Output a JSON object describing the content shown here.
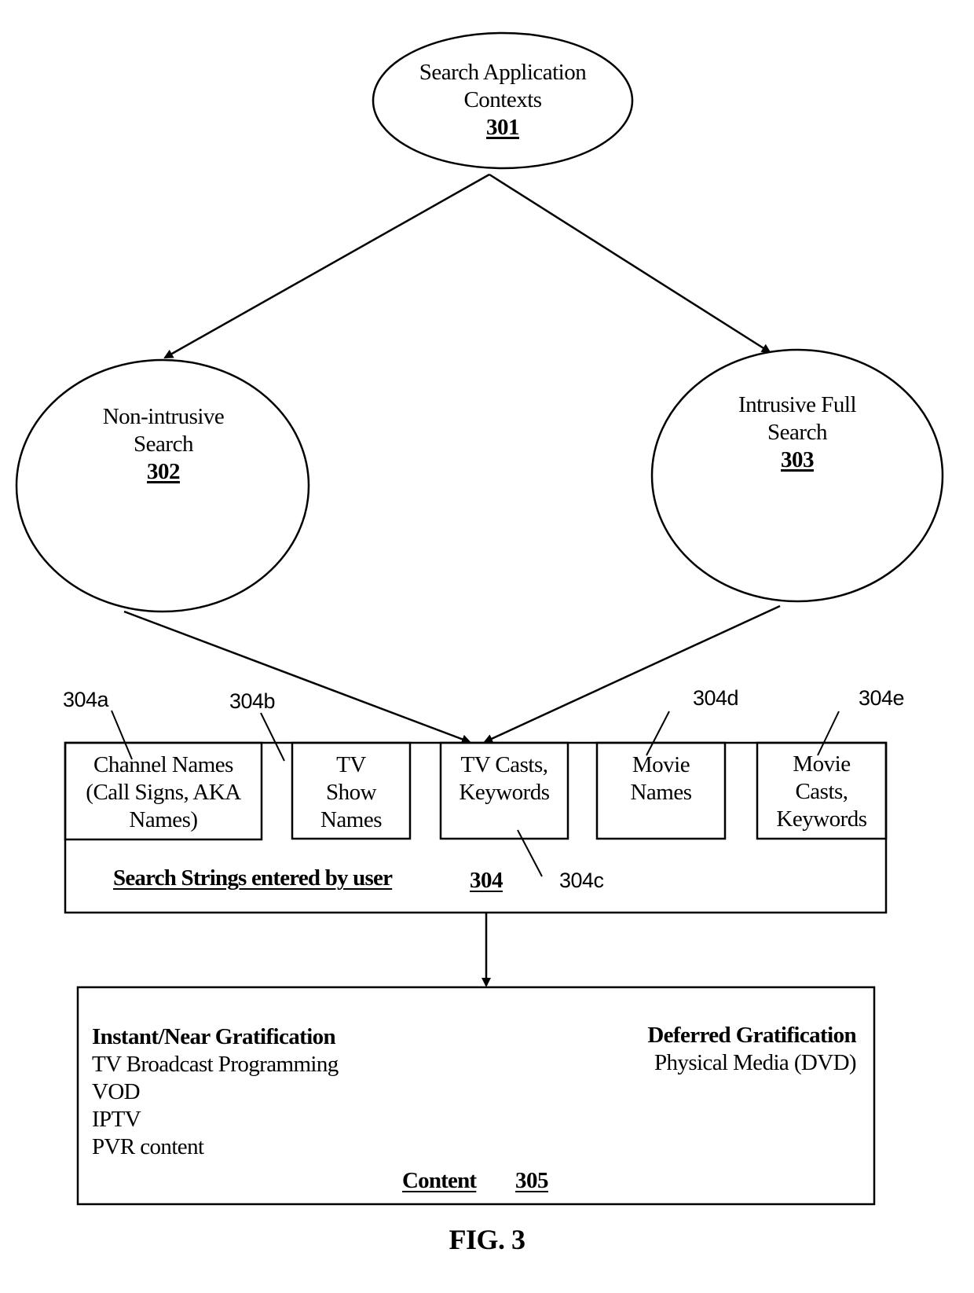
{
  "figure_label": "FIG. 3",
  "nodes": {
    "n301": {
      "lines": [
        "Search Application",
        "Contexts"
      ],
      "ref": "301"
    },
    "n302": {
      "lines": [
        "Non-intrusive",
        "Search"
      ],
      "ref": "302"
    },
    "n303": {
      "lines": [
        "Intrusive Full",
        "Search"
      ],
      "ref": "303"
    }
  },
  "search_strings": {
    "title": "Search Strings entered by user",
    "ref": "304",
    "boxes": [
      {
        "ref": "304a",
        "lines": [
          "Channel Names",
          "(Call Signs, AKA",
          "Names)"
        ]
      },
      {
        "ref": "304b",
        "lines": [
          "TV",
          "Show",
          "Names"
        ]
      },
      {
        "ref": "304c",
        "lines": [
          "TV Casts,",
          "Keywords"
        ]
      },
      {
        "ref": "304d",
        "lines": [
          "Movie",
          "Names"
        ]
      },
      {
        "ref": "304e",
        "lines": [
          "Movie",
          "Casts,",
          "Keywords"
        ]
      }
    ]
  },
  "content": {
    "title": "Content",
    "ref": "305",
    "instant": {
      "heading": "Instant/Near Gratification",
      "items": [
        "TV Broadcast Programming",
        "VOD",
        "IPTV",
        "PVR content"
      ]
    },
    "deferred": {
      "heading": "Deferred Gratification",
      "items": [
        "Physical Media (DVD)"
      ]
    }
  }
}
